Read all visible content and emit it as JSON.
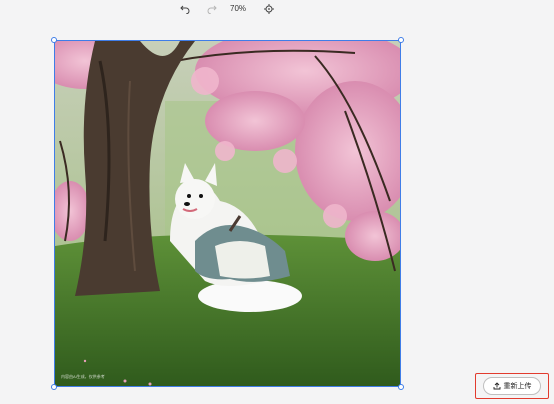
{
  "toolbar": {
    "zoom_label": "70%",
    "icons": [
      "undo-icon",
      "redo-icon",
      "target-icon"
    ]
  },
  "image": {
    "watermark_text": "内容由AI生成，仅供参考"
  },
  "actions": {
    "reupload_label": "重新上传",
    "reupload_icon": "upload-icon"
  },
  "colors": {
    "selection": "#3f7de8",
    "highlight_box": "#e23b2e",
    "background": "#f4f4f5"
  }
}
